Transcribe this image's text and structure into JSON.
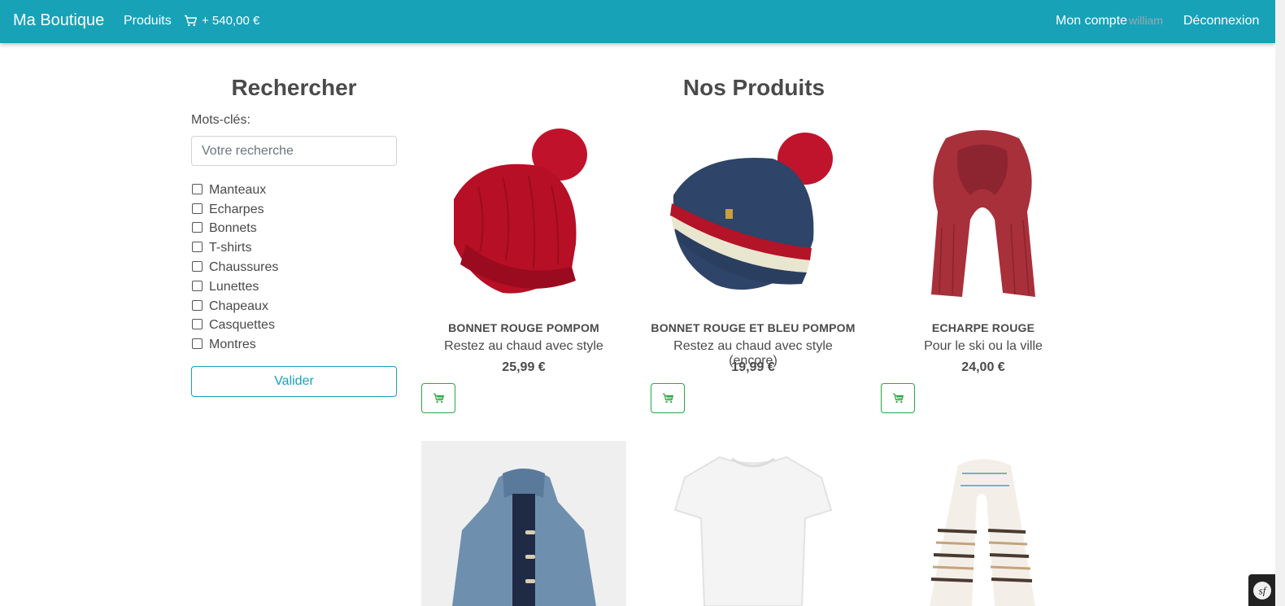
{
  "navbar": {
    "brand": "Ma Boutique",
    "products_link": "Produits",
    "cart_total": "+ 540,00 €",
    "account_link": "Mon compte",
    "username": "william",
    "logout_link": "Déconnexion",
    "background_color": "#17a2b8"
  },
  "sidebar": {
    "title": "Rechercher",
    "keywords_label": "Mots-clés:",
    "search_placeholder": "Votre recherche",
    "search_value": "",
    "categories": [
      "Manteaux",
      "Echarpes",
      "Bonnets",
      "T-shirts",
      "Chaussures",
      "Lunettes",
      "Chapeaux",
      "Casquettes",
      "Montres"
    ],
    "submit_label": "Valider"
  },
  "main": {
    "title": "Nos Produits",
    "products": [
      {
        "name": "BONNET ROUGE POMPOM",
        "subtitle": "Restez au chaud avec style",
        "price": "25,99 €",
        "image": "red-pompom-beanie"
      },
      {
        "name": "BONNET ROUGE ET BLEU POMPOM",
        "subtitle": "Restez au chaud avec style (encore)",
        "price": "19,99 €",
        "image": "blue-red-pompom-beanie"
      },
      {
        "name": "ECHARPE ROUGE",
        "subtitle": "Pour le ski ou la ville",
        "price": "24,00 €",
        "image": "red-scarf"
      },
      {
        "name": "",
        "subtitle": "",
        "price": "",
        "image": "denim-duffle-coat"
      },
      {
        "name": "",
        "subtitle": "",
        "price": "",
        "image": "white-tshirt"
      },
      {
        "name": "",
        "subtitle": "",
        "price": "",
        "image": "striped-scarf"
      }
    ]
  },
  "icons": {
    "cart": "cart-icon",
    "symfony": "symfony-toolbar-icon"
  },
  "colors": {
    "accent": "#17a2b8",
    "success": "#28a745"
  }
}
